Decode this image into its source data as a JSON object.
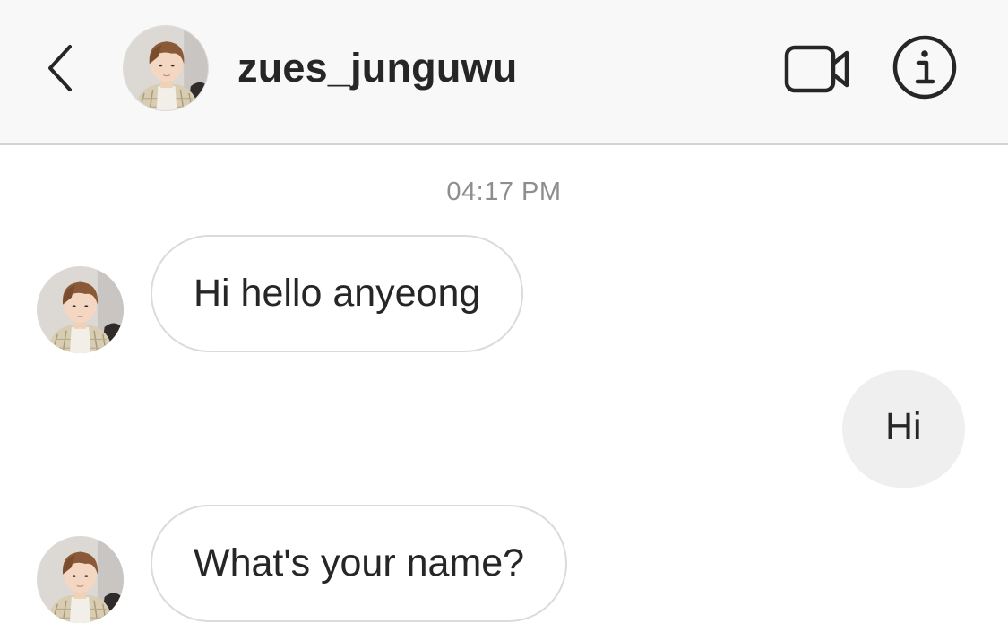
{
  "header": {
    "username": "zues_junguwu",
    "back_icon": "chevron-left-icon",
    "video_icon": "video-camera-icon",
    "info_icon": "info-icon"
  },
  "thread": {
    "timestamp": "04:17 PM",
    "messages": [
      {
        "direction": "incoming",
        "text": "Hi hello anyeong"
      },
      {
        "direction": "outgoing",
        "text": "Hi"
      },
      {
        "direction": "incoming",
        "text": "What's your name?"
      }
    ]
  },
  "colors": {
    "header_bg": "#f8f8f8",
    "incoming_border": "#dbdbdb",
    "outgoing_bg": "#efefef",
    "timestamp_text": "#8e8e8e",
    "primary_text": "#262626"
  }
}
